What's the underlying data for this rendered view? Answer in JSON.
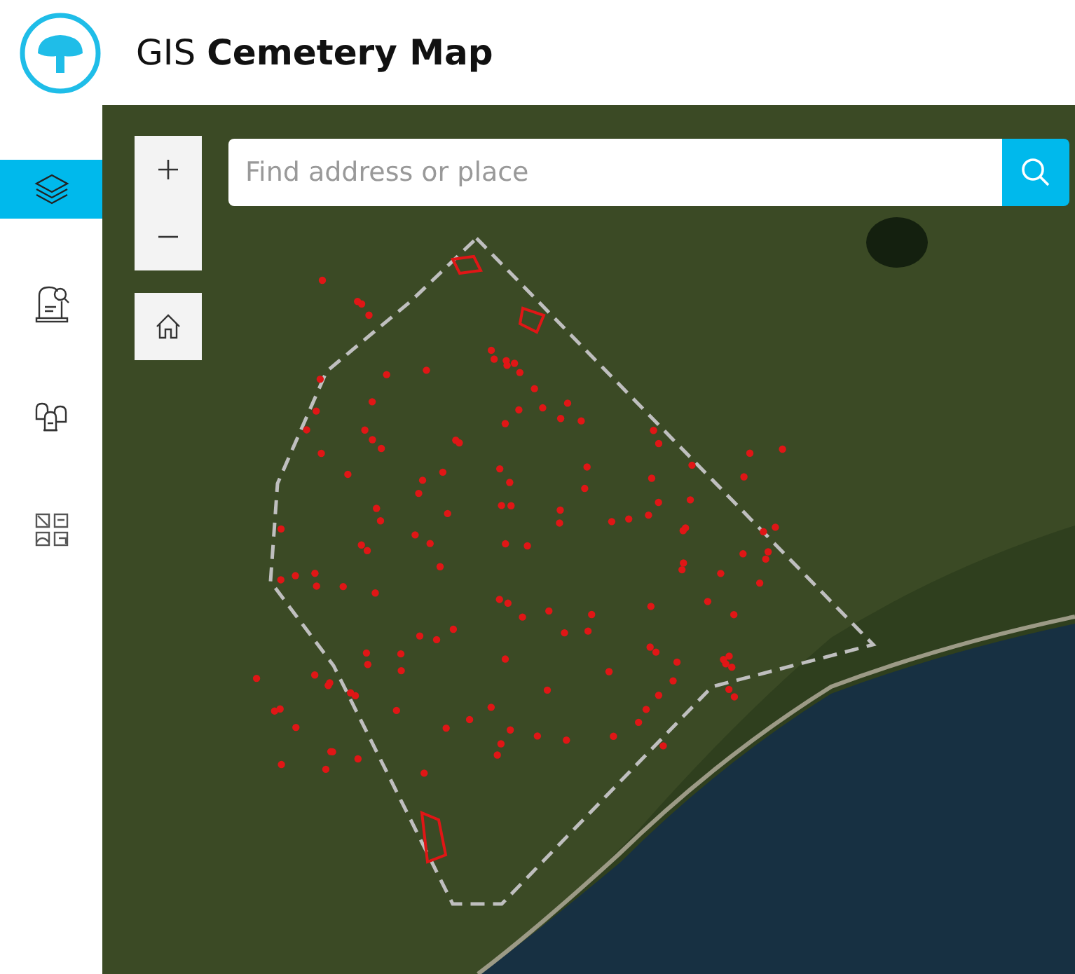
{
  "header": {
    "title": "GIS **Cemetery Map**"
  },
  "sidebar": {
    "items": [
      {
        "kind": "layers",
        "selected": true
      },
      {
        "kind": "search",
        "selected": false
      },
      {
        "kind": "graves",
        "selected": false
      },
      {
        "kind": "gallery",
        "selected": false
      }
    ]
  },
  "search": {
    "placeholder": "Find address or place"
  }
}
